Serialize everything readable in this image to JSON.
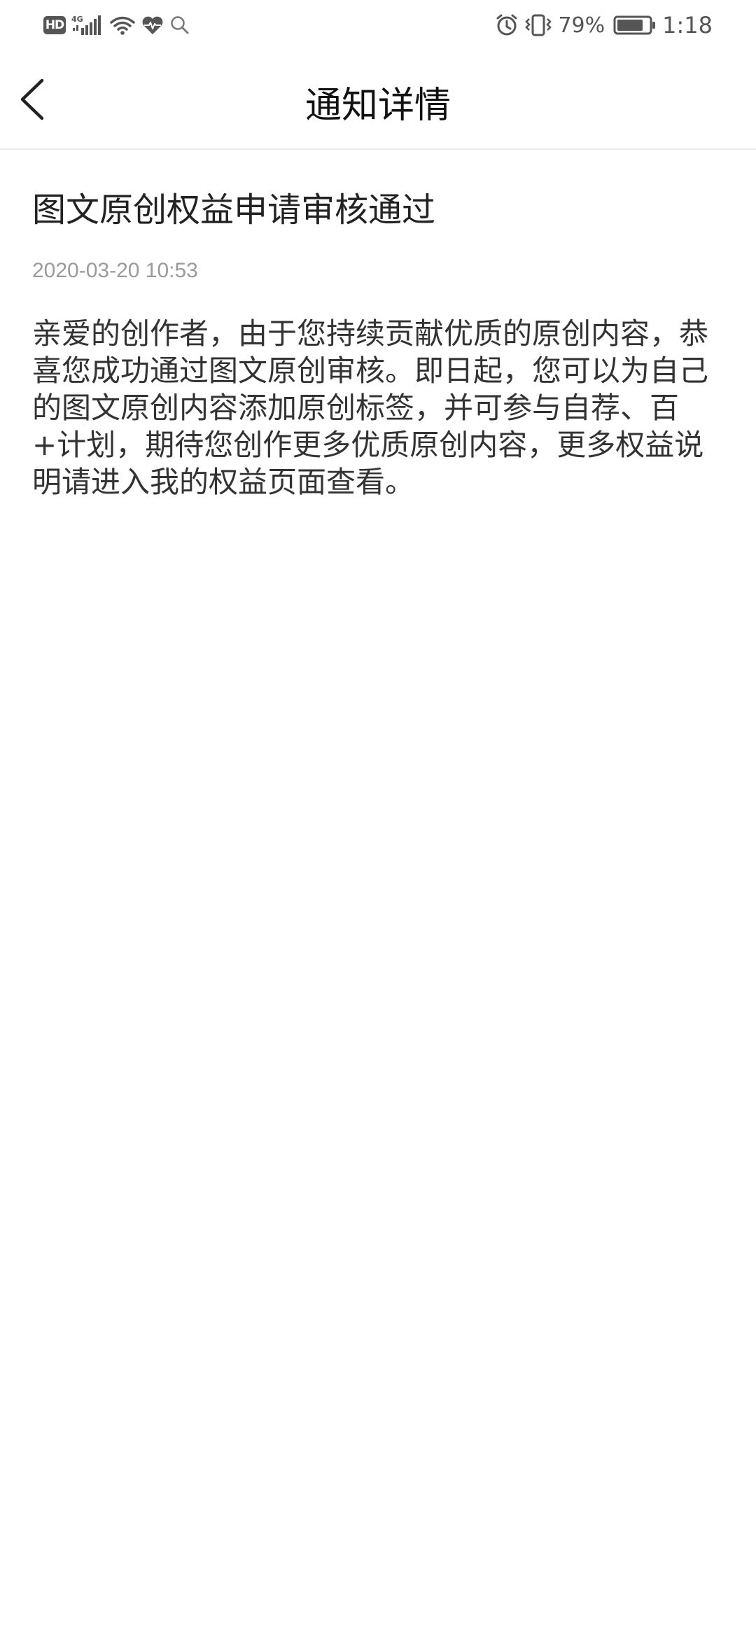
{
  "status_bar": {
    "hd_label": "HD",
    "network_label": "4G",
    "battery_percent": "79%",
    "time": "1:18",
    "icons": [
      "hd-icon",
      "signal-icon",
      "wifi-icon",
      "health-icon",
      "search-icon",
      "alarm-icon",
      "vibrate-icon",
      "battery-icon"
    ]
  },
  "header": {
    "title": "通知详情",
    "back_icon": "chevron-left-icon"
  },
  "notice": {
    "title": "图文原创权益申请审核通过",
    "time": "2020-03-20 10:53",
    "body": "亲爱的创作者，由于您持续贡献优质的原创内容，恭喜您成功通过图文原创审核。即日起，您可以为自己的图文原创内容添加原创标签，并可参与自荐、百+计划，期待您创作更多优质原创内容，更多权益说明请进入我的权益页面查看。"
  }
}
